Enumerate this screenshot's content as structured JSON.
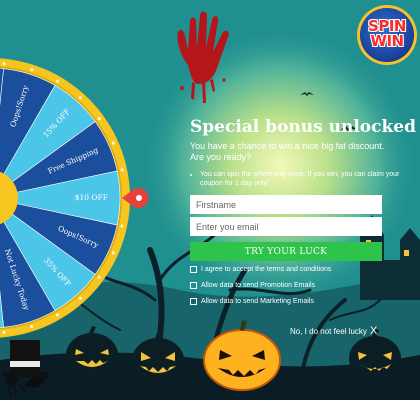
{
  "brand": {
    "logo_line1": "SPIN",
    "logo_line2": "WIN"
  },
  "colors": {
    "background": "#1f8f8f",
    "wheel_dark": "#1b4e9c",
    "wheel_light": "#4cc6e8",
    "wheel_rim": "#f7c51f",
    "pointer": "#e8403a",
    "cta": "#2ec34a",
    "hand": "#b5161a"
  },
  "headline": "Special bonus unlocked",
  "subtext": "You have a chance to win a nice big fat discount. Are you ready?",
  "rules": [
    "You can spin the wheel only once. If you win, you can claim your coupon for 1 day only!"
  ],
  "form": {
    "firstname_placeholder": "Firstname",
    "email_placeholder": "Enter you email",
    "submit_label": "TRY YOUR LUCK"
  },
  "checkboxes": [
    {
      "label": "I agree to accept the terms and conditions",
      "checked": false
    },
    {
      "label": "Allow data to send Promotion Emails",
      "checked": false
    },
    {
      "label": "Allow data to send Marketing Emails",
      "checked": false
    }
  ],
  "dismiss": {
    "label": "No, I do not feel lucky",
    "close_glyph": "X"
  },
  "wheel": {
    "segments": [
      "Oops!Sorry",
      "15% OFF",
      "Free Shipping",
      "$10 OFF",
      "Oops!Sorry",
      "35% OFF",
      "Not Lucky Today"
    ]
  },
  "icons": [
    "bloody-hand-icon",
    "pumpkin-icon",
    "top-hat-icon",
    "crow-icon",
    "pointer-icon",
    "close-icon"
  ]
}
